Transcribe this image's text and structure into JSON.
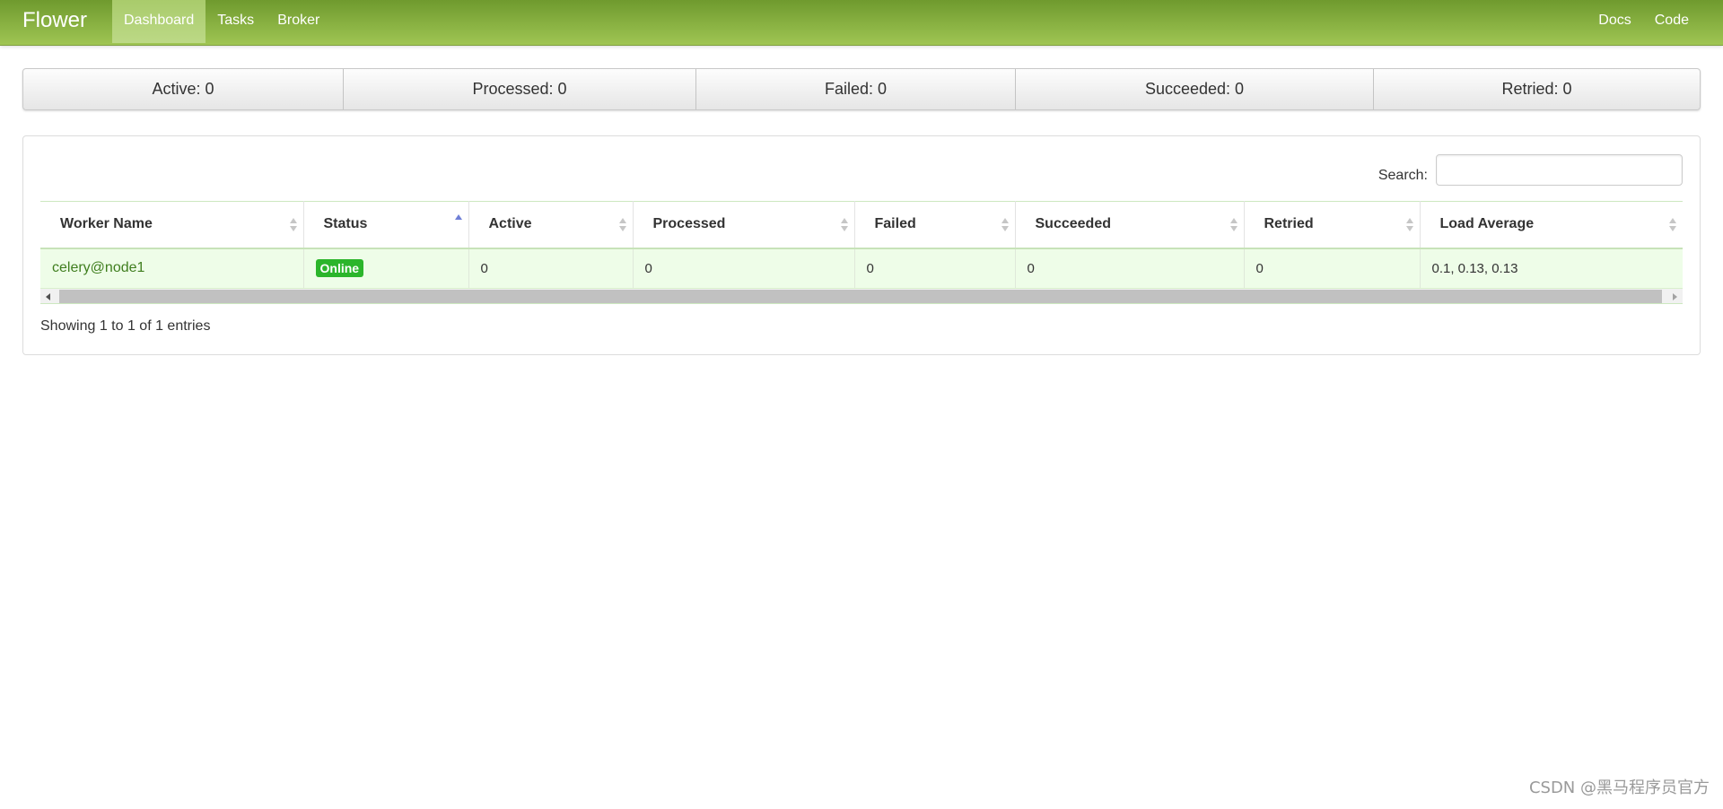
{
  "navbar": {
    "brand": "Flower",
    "left_items": [
      {
        "label": "Dashboard",
        "active": true
      },
      {
        "label": "Tasks",
        "active": false
      },
      {
        "label": "Broker",
        "active": false
      }
    ],
    "right_items": [
      {
        "label": "Docs"
      },
      {
        "label": "Code"
      }
    ],
    "colors": {
      "top": "#6f9a2e",
      "bottom": "#9fc553"
    }
  },
  "counters": [
    {
      "label": "Active",
      "value": "0"
    },
    {
      "label": "Processed",
      "value": "0"
    },
    {
      "label": "Failed",
      "value": "0"
    },
    {
      "label": "Succeeded",
      "value": "0"
    },
    {
      "label": "Retried",
      "value": "0"
    }
  ],
  "search": {
    "label": "Search:",
    "value": "",
    "placeholder": ""
  },
  "table": {
    "columns": [
      {
        "label": "Worker Name",
        "sort": "none"
      },
      {
        "label": "Status",
        "sort": "asc"
      },
      {
        "label": "Active",
        "sort": "none"
      },
      {
        "label": "Processed",
        "sort": "none"
      },
      {
        "label": "Failed",
        "sort": "none"
      },
      {
        "label": "Succeeded",
        "sort": "none"
      },
      {
        "label": "Retried",
        "sort": "none"
      },
      {
        "label": "Load Average",
        "sort": "none"
      }
    ],
    "rows": [
      {
        "worker_name": "celery@node1",
        "status": "Online",
        "active": "0",
        "processed": "0",
        "failed": "0",
        "succeeded": "0",
        "retried": "0",
        "load_average": "0.1, 0.13, 0.13"
      }
    ],
    "info": "Showing 1 to 1 of 1 entries"
  },
  "status_color": "#2bb52b",
  "watermark": "CSDN @黑马程序员官方"
}
